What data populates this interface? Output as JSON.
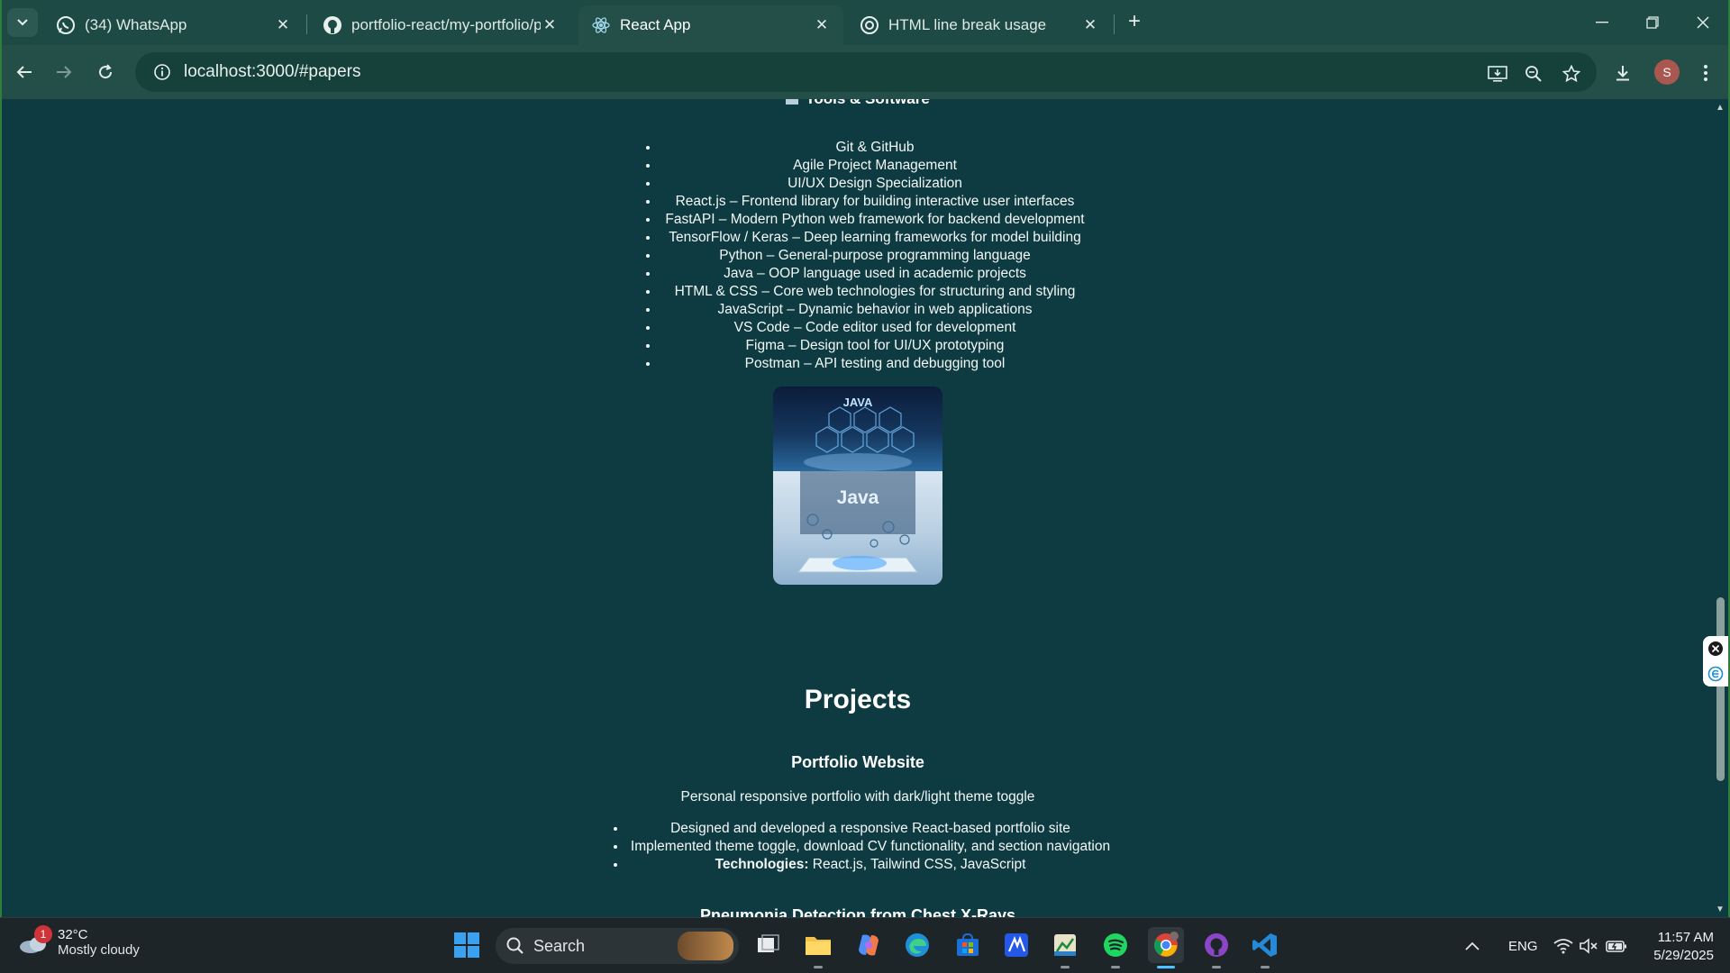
{
  "browser": {
    "tabs": [
      {
        "title": "(34) WhatsApp",
        "icon": "whatsapp-icon",
        "active": false
      },
      {
        "title": "portfolio-react/my-portfolio/pu",
        "icon": "github-icon",
        "active": false
      },
      {
        "title": "React App",
        "icon": "react-icon",
        "active": true
      },
      {
        "title": "HTML line break usage",
        "icon": "chatgpt-icon",
        "active": false
      }
    ],
    "close_glyph": "✕",
    "new_tab_glyph": "+",
    "url": "localhost:3000/#papers",
    "profile_initial": "S",
    "accent": "#244f48"
  },
  "page": {
    "tools_heading": "Tools & Software",
    "tools": [
      "Git & GitHub",
      "Agile Project Management",
      "UI/UX Design Specialization",
      "React.js – Frontend library for building interactive user interfaces",
      "FastAPI – Modern Python web framework for backend development",
      "TensorFlow / Keras – Deep learning frameworks for model building",
      "Python – General-purpose programming language",
      "Java – OOP language used in academic projects",
      "HTML & CSS – Core web technologies for structuring and styling",
      "JavaScript – Dynamic behavior in web applications",
      "VS Code – Code editor used for development",
      "Figma – Design tool for UI/UX prototyping",
      "Postman – API testing and debugging tool"
    ],
    "image_top_text": "JAVA",
    "image_bottom_text": "Java",
    "projects_title": "Projects",
    "project": {
      "title": "Portfolio Website",
      "description": "Personal responsive portfolio with dark/light theme toggle",
      "bullets": [
        "Designed and developed a responsive React-based portfolio site",
        "Implemented theme toggle, download CV functionality, and section navigation"
      ],
      "tech_label": "Technologies:",
      "tech_value": " React.js, Tailwind CSS, JavaScript"
    },
    "next_project_title": "Pneumonia Detection from Chest X-Rays",
    "background": "#0e3b41"
  },
  "taskbar": {
    "weather": {
      "badge": "1",
      "temp": "32°C",
      "condition": "Mostly cloudy"
    },
    "search_placeholder": "Search",
    "language": "ENG",
    "time": "11:57 AM",
    "date": "5/29/2025"
  }
}
